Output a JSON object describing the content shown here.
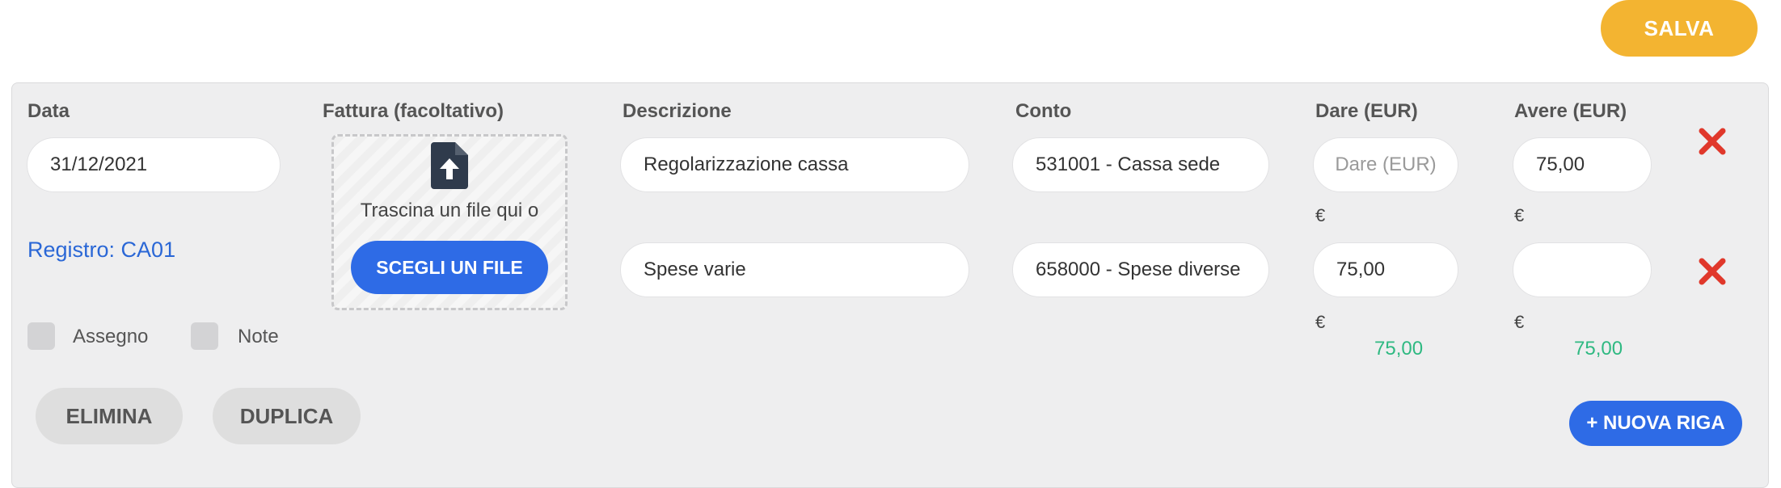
{
  "toolbar": {
    "save_label": "SALVA"
  },
  "columns": {
    "date": "Data",
    "invoice": "Fattura (facoltativo)",
    "description": "Descrizione",
    "account": "Conto",
    "debit": "Dare (EUR)",
    "credit": "Avere (EUR)"
  },
  "entry": {
    "date": "31/12/2021",
    "register": "Registro: CA01",
    "checkboxes": {
      "check": "Assegno",
      "notes": "Note"
    }
  },
  "upload": {
    "drop_text": "Trascina un file qui o",
    "choose_label": "SCEGLI UN FILE"
  },
  "rows": [
    {
      "description": "Regolarizzazione cassa",
      "account": "531001 - Cassa sede",
      "debit": "",
      "debit_placeholder": "Dare (EUR)",
      "credit": "75,00",
      "currency": "€"
    },
    {
      "description": "Spese varie",
      "account": "658000 - Spese diverse",
      "debit": "75,00",
      "credit": "",
      "currency": "€"
    }
  ],
  "totals": {
    "debit": "75,00",
    "credit": "75,00"
  },
  "actions": {
    "delete_label": "ELIMINA",
    "duplicate_label": "DUPLICA",
    "new_row_label": "+ NUOVA RIGA"
  },
  "colors": {
    "save": "#f3b431",
    "primary": "#2e6be6",
    "total": "#2fb982",
    "remove": "#e0382b",
    "link": "#2a67d6"
  },
  "icons": {
    "upload": "file-upload-icon",
    "remove": "close-icon"
  }
}
